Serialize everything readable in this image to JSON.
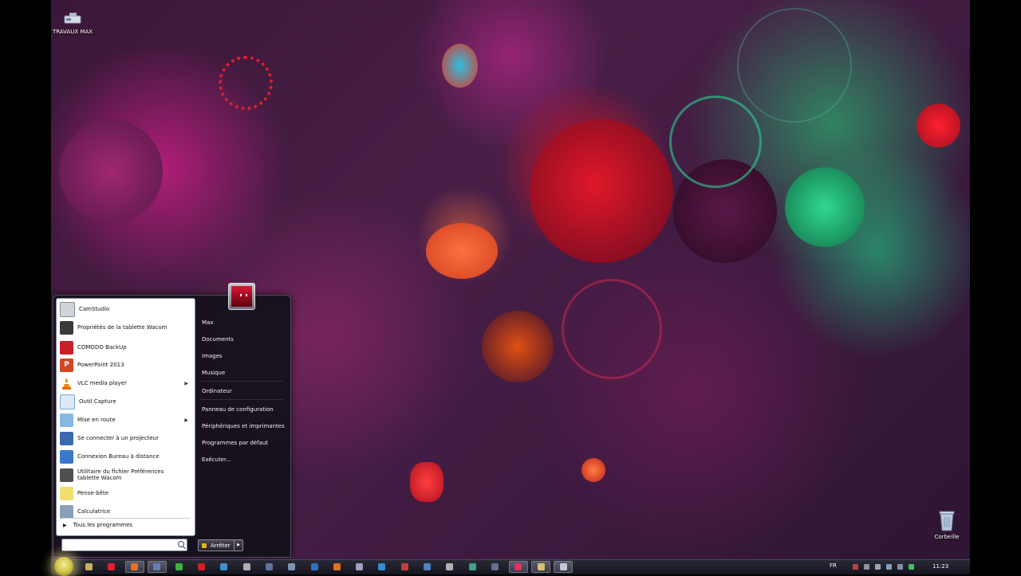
{
  "desktop": {
    "icons": [
      {
        "label": "TRAVAUX MAX",
        "icon": "usb-drive-icon"
      },
      {
        "label": "Corbeille",
        "icon": "recycle-bin-icon"
      }
    ]
  },
  "start_menu": {
    "programs": [
      {
        "label": "CamStudio",
        "icon": "camstudio-icon",
        "color": "#cfd4dc",
        "has_submenu": false
      },
      {
        "label": "Propriétés de la tablette Wacom",
        "icon": "wacom-tablet-icon",
        "color": "#3a3a3a",
        "has_submenu": false
      },
      {
        "label": "COMODO BackUp",
        "icon": "comodo-backup-icon",
        "color": "#c8202a",
        "has_submenu": false
      },
      {
        "label": "PowerPoint 2013",
        "icon": "powerpoint-icon",
        "color": "#d24625",
        "has_submenu": false
      },
      {
        "label": "VLC media player",
        "icon": "vlc-cone-icon",
        "color": "#f08a10",
        "has_submenu": true
      },
      {
        "label": "Outil Capture",
        "icon": "snipping-tool-icon",
        "color": "#7aa8d8",
        "has_submenu": false
      },
      {
        "label": "Mise en route",
        "icon": "getting-started-icon",
        "color": "#88b8e0",
        "has_submenu": true
      },
      {
        "label": "Se connecter à un projecteur",
        "icon": "projector-icon",
        "color": "#3a6ab0",
        "has_submenu": false
      },
      {
        "label": "Connexion Bureau à distance",
        "icon": "remote-desktop-icon",
        "color": "#3a78c8",
        "has_submenu": false
      },
      {
        "label": "Utilitaire du fichier Préférences tablette Wacom",
        "icon": "wacom-utility-icon",
        "color": "#505050",
        "has_submenu": false
      },
      {
        "label": "Pense-bête",
        "icon": "sticky-notes-icon",
        "color": "#f0e070",
        "has_submenu": false
      },
      {
        "label": "Calculatrice",
        "icon": "calculator-icon",
        "color": "#8aa0b8",
        "has_submenu": false
      }
    ],
    "all_programs": "Tous les programmes",
    "search_placeholder": "",
    "places": [
      {
        "label": "Max"
      },
      {
        "label": "Documents"
      },
      {
        "label": "Images"
      },
      {
        "label": "Musique"
      },
      {
        "label": "Ordinateur"
      },
      {
        "label": "Panneau de configuration"
      },
      {
        "label": "Périphériques et imprimantes"
      },
      {
        "label": "Programmes par défaut"
      },
      {
        "label": "Exécuter..."
      }
    ],
    "shutdown_label": "Arrêter"
  },
  "taskbar": {
    "pinned": [
      {
        "name": "explorer-icon",
        "color": "#c8b060",
        "active": false
      },
      {
        "name": "opera-icon",
        "color": "#e02030",
        "active": false
      },
      {
        "name": "firefox-icon",
        "color": "#e87020",
        "active": true
      },
      {
        "name": "screen-icon",
        "color": "#6080b0",
        "active": true
      },
      {
        "name": "green-app-icon",
        "color": "#40b040",
        "active": false
      },
      {
        "name": "stop-icon",
        "color": "#d02020",
        "active": false
      },
      {
        "name": "blue-app-icon",
        "color": "#4090d0",
        "active": false
      },
      {
        "name": "flag-icon",
        "color": "#b0b0b0",
        "active": false
      },
      {
        "name": "gear-app-icon",
        "color": "#6070a0",
        "active": false
      },
      {
        "name": "pen-icon",
        "color": "#8090b0",
        "active": false
      },
      {
        "name": "drop-icon",
        "color": "#3070c0",
        "active": false
      },
      {
        "name": "blender-icon",
        "color": "#e07020",
        "active": false
      },
      {
        "name": "cube-icon",
        "color": "#a0a0c0",
        "active": false
      },
      {
        "name": "globe-icon",
        "color": "#3090d0",
        "active": false
      },
      {
        "name": "paint-icon",
        "color": "#c04040",
        "active": false
      },
      {
        "name": "chart-app-icon",
        "color": "#5080c0",
        "active": false
      },
      {
        "name": "inkscape-icon",
        "color": "#b0b0b0",
        "active": false
      },
      {
        "name": "shield-icon",
        "color": "#40a080",
        "active": false
      },
      {
        "name": "steam-icon",
        "color": "#607090",
        "active": false
      },
      {
        "name": "record-icon",
        "color": "#e03060",
        "active": true
      },
      {
        "name": "folder-icon",
        "color": "#d8c070",
        "active": true
      },
      {
        "name": "window-icon",
        "color": "#c0c8d8",
        "active": true
      }
    ],
    "language": "FR",
    "tray": [
      {
        "name": "flag-tray-icon",
        "color": "#c04040"
      },
      {
        "name": "network-tray-icon",
        "color": "#9090a0"
      },
      {
        "name": "volume-tray-icon",
        "color": "#a0a0b0"
      },
      {
        "name": "sync-tray-icon",
        "color": "#80a0c0"
      },
      {
        "name": "drive-tray-icon",
        "color": "#8090a0"
      },
      {
        "name": "green-tray-icon",
        "color": "#40c060"
      }
    ],
    "clock": "11:23"
  }
}
